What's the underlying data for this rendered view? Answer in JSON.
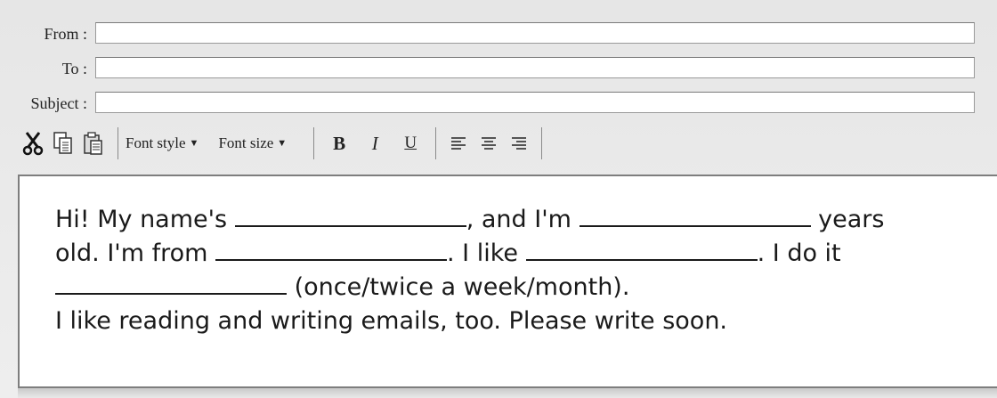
{
  "fields": [
    {
      "label": "From :",
      "value": ""
    },
    {
      "label": "To :",
      "value": ""
    },
    {
      "label": "Subject :",
      "value": ""
    }
  ],
  "toolbar": {
    "cut_icon": "scissors-icon",
    "copy_icon": "copy-icon",
    "paste_icon": "paste-icon",
    "font_style": "Font style",
    "font_size": "Font size",
    "bold": "B",
    "italic": "I",
    "underline": "U"
  },
  "message": {
    "l1a": "Hi! My name's ",
    "l1b": ", and I'm ",
    "l1c": " years",
    "l2a": "old. I'm from ",
    "l2b": ". I like ",
    "l2c": ". I do it",
    "l3": " (once/twice a week/month).",
    "l4": "I like reading and writing emails, too. Please write soon."
  }
}
